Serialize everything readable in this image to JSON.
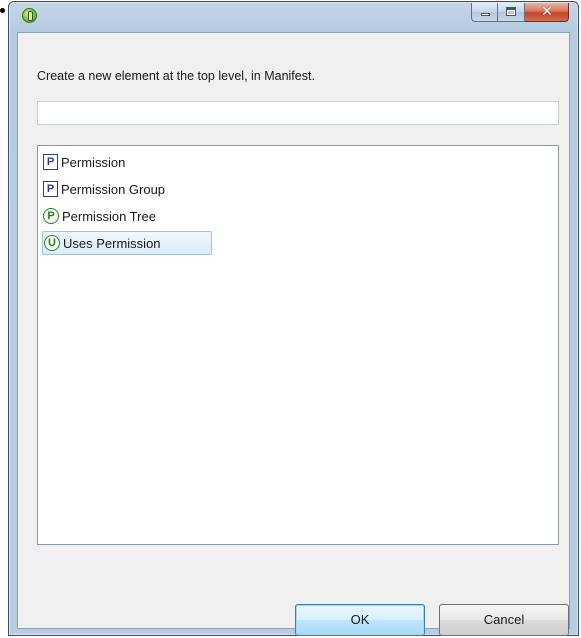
{
  "dialog": {
    "title": "",
    "prompt": "Create a new element at the top level, in Manifest.",
    "filter": {
      "value": "",
      "placeholder": ""
    },
    "items": [
      {
        "glyph": "P",
        "icon": "permission-icon",
        "label": "Permission"
      },
      {
        "glyph": "P",
        "icon": "permission-group-icon",
        "label": "Permission Group"
      },
      {
        "glyph": "P",
        "icon": "permission-tree-icon",
        "label": "Permission Tree"
      },
      {
        "glyph": "U",
        "icon": "uses-permission-icon",
        "label": "Uses Permission",
        "selected": true
      }
    ],
    "buttons": {
      "ok": "OK",
      "cancel": "Cancel"
    }
  }
}
